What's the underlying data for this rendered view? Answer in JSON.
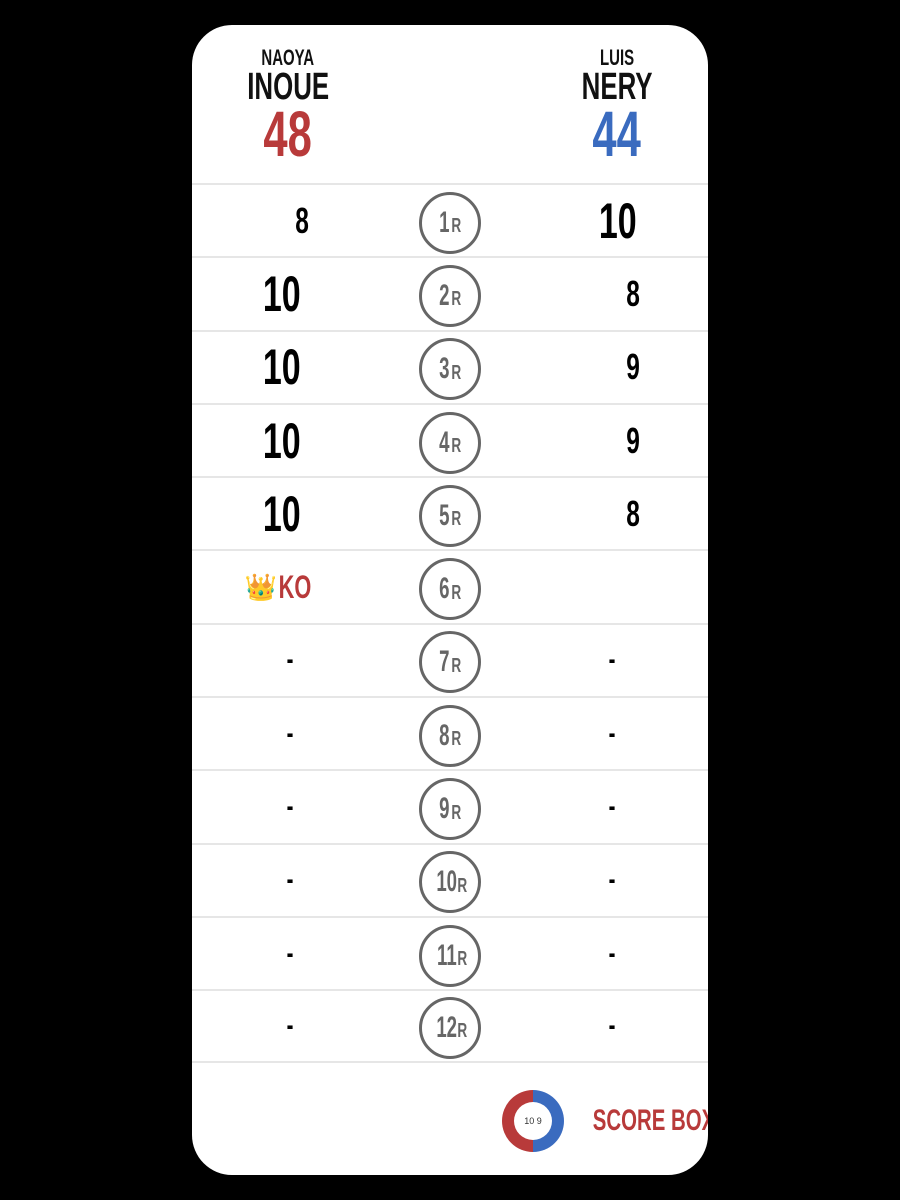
{
  "fighters": {
    "left": {
      "first_name": "NAOYA",
      "last_name": "INOUE",
      "total": "48",
      "color": "#b83a3a"
    },
    "right": {
      "first_name": "LUIS",
      "last_name": "NERY",
      "total": "44",
      "color": "#3a6bbf"
    }
  },
  "rounds": [
    {
      "label": "1",
      "suffix": "R",
      "left": "8",
      "right": "10"
    },
    {
      "label": "2",
      "suffix": "R",
      "left": "10",
      "right": "8"
    },
    {
      "label": "3",
      "suffix": "R",
      "left": "10",
      "right": "9"
    },
    {
      "label": "4",
      "suffix": "R",
      "left": "10",
      "right": "9"
    },
    {
      "label": "5",
      "suffix": "R",
      "left": "10",
      "right": "8"
    },
    {
      "label": "6",
      "suffix": "R",
      "left": "KO",
      "left_icon": "👑",
      "right": ""
    },
    {
      "label": "7",
      "suffix": "R",
      "left": "-",
      "right": "-"
    },
    {
      "label": "8",
      "suffix": "R",
      "left": "-",
      "right": "-"
    },
    {
      "label": "9",
      "suffix": "R",
      "left": "-",
      "right": "-"
    },
    {
      "label": "10",
      "suffix": "R",
      "left": "-",
      "right": "-"
    },
    {
      "label": "11",
      "suffix": "R",
      "left": "-",
      "right": "-"
    },
    {
      "label": "12",
      "suffix": "R",
      "left": "-",
      "right": "-"
    }
  ],
  "brand": {
    "name": "SCORE BOX",
    "logo_icon": "boxing-gloves-icon",
    "logo_text_left": "10",
    "logo_text_right": "9"
  }
}
